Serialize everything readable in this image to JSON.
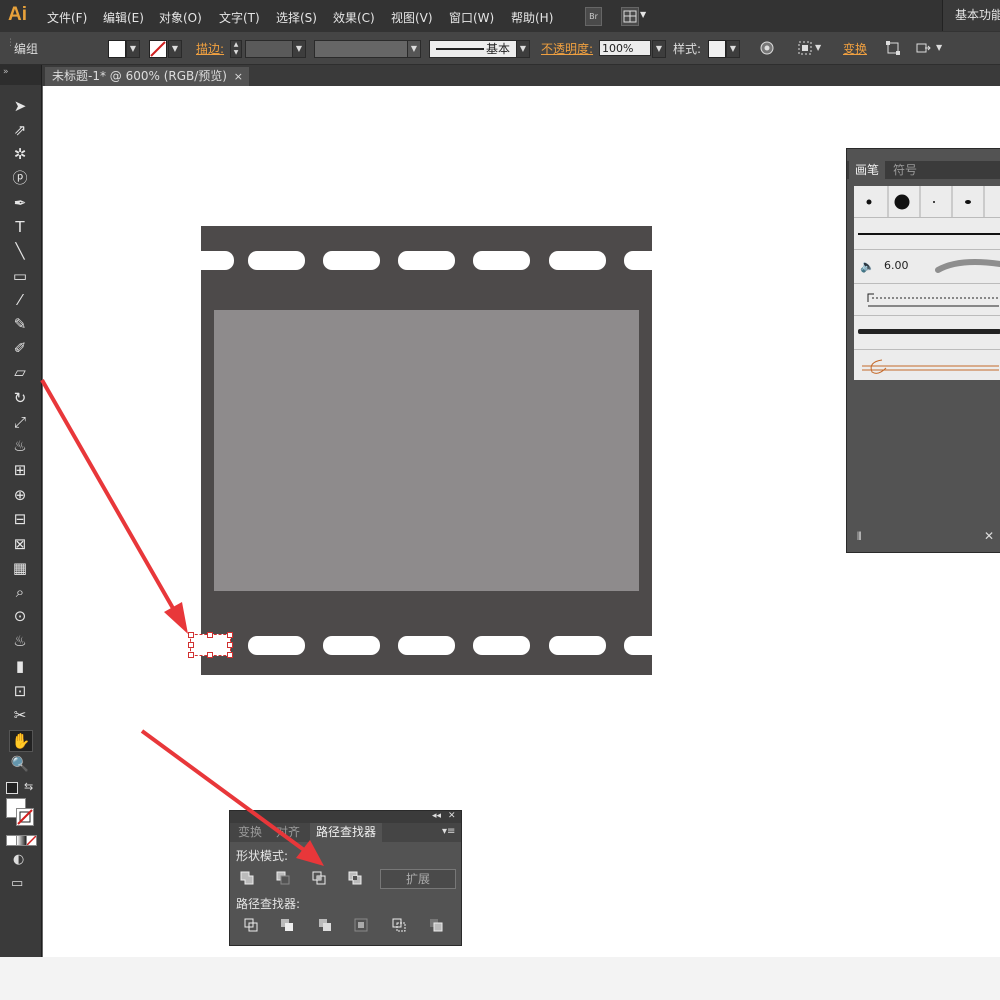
{
  "app": {
    "logo": "Ai",
    "workspace": "基本功能"
  },
  "menu": [
    {
      "label": "文件(F)"
    },
    {
      "label": "编辑(E)"
    },
    {
      "label": "对象(O)"
    },
    {
      "label": "文字(T)"
    },
    {
      "label": "选择(S)"
    },
    {
      "label": "效果(C)"
    },
    {
      "label": "视图(V)"
    },
    {
      "label": "窗口(W)"
    },
    {
      "label": "帮助(H)"
    }
  ],
  "menu_buttons": {
    "bridge": "Br",
    "arrange": "arrange-documents-icon"
  },
  "control": {
    "selection": "编组",
    "stroke_label": "描边:",
    "stroke_profile": "基本",
    "opacity_label": "不透明度:",
    "opacity_value": "100%",
    "style_label": "样式:",
    "transform_label": "变换",
    "fill_color": "#ffffff",
    "accent_color": "#f0a040"
  },
  "document_tab": {
    "title": "未标题-1* @ 600% (RGB/预览)",
    "close": "×"
  },
  "tools": [
    "selection-tool-icon",
    "direct-selection-tool-icon",
    "magic-wand-tool-icon",
    "lasso-tool-icon",
    "pen-tool-icon",
    "type-tool-icon",
    "line-tool-icon",
    "rectangle-tool-icon",
    "paintbrush-tool-icon",
    "pencil-tool-icon",
    "blob-brush-tool-icon",
    "eraser-tool-icon",
    "rotate-tool-icon",
    "scale-tool-icon",
    "warp-tool-icon",
    "free-transform-tool-icon",
    "shape-builder-tool-icon",
    "perspective-grid-tool-icon",
    "mesh-tool-icon",
    "gradient-tool-icon",
    "eyedropper-tool-icon",
    "blend-tool-icon",
    "symbol-sprayer-tool-icon",
    "column-graph-tool-icon",
    "artboard-tool-icon",
    "slice-tool-icon",
    "hand-tool-icon",
    "zoom-tool-icon"
  ],
  "brushes_panel": {
    "tabs": [
      "画笔",
      "符号"
    ],
    "brush_size": "6.00"
  },
  "pathfinder_panel": {
    "tabs": [
      "变换",
      "对齐",
      "路径查找器"
    ],
    "shape_modes_label": "形状模式:",
    "pathfinders_label": "路径查找器:",
    "expand_label": "扩展",
    "shape_modes": [
      "unite-icon",
      "minus-front-icon",
      "intersect-icon",
      "exclude-icon"
    ],
    "pathfinders": [
      "divide-icon",
      "trim-icon",
      "merge-icon",
      "crop-icon",
      "outline-icon",
      "minus-back-icon"
    ]
  },
  "colors": {
    "film": "#4d4a4a",
    "frame": "#8e8b8c",
    "annotation_arrow": "#e8373a"
  }
}
